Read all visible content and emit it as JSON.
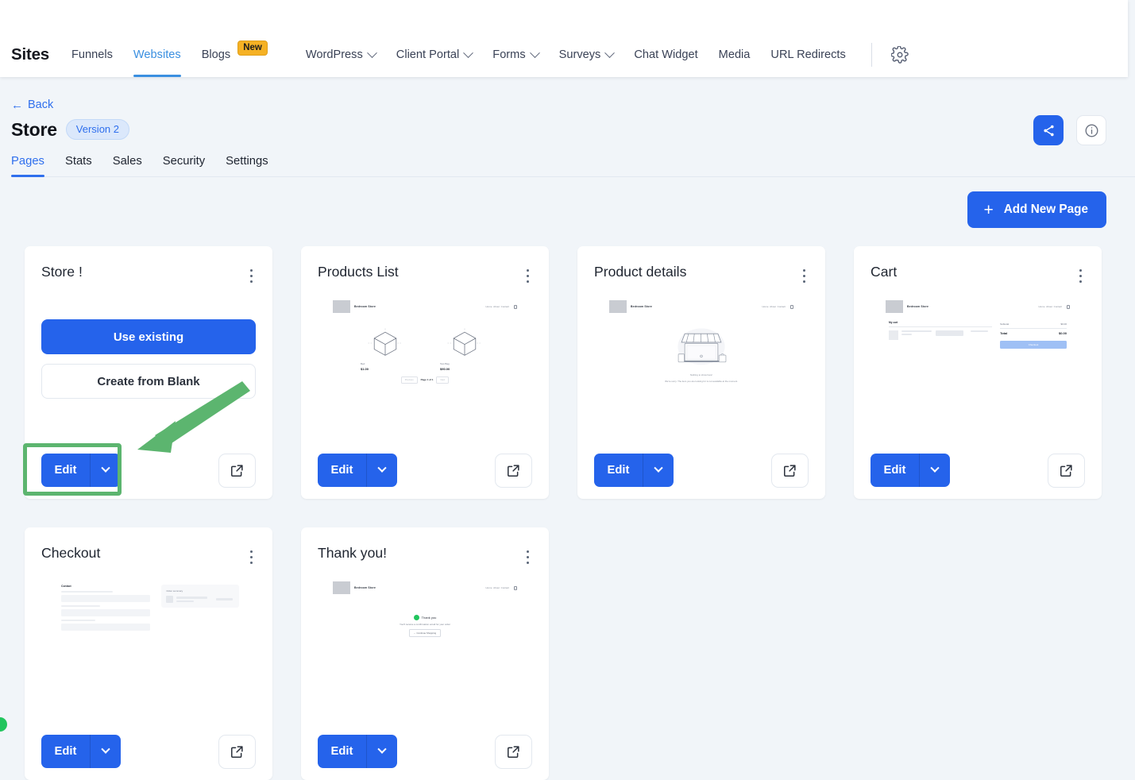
{
  "topnav": {
    "brand": "Sites",
    "items": [
      {
        "label": "Funnels",
        "active": false,
        "caret": false,
        "badge": null
      },
      {
        "label": "Websites",
        "active": true,
        "caret": false,
        "badge": null
      },
      {
        "label": "Blogs",
        "active": false,
        "caret": false,
        "badge": "New"
      },
      {
        "label": "WordPress",
        "active": false,
        "caret": true,
        "badge": null
      },
      {
        "label": "Client Portal",
        "active": false,
        "caret": true,
        "badge": null
      },
      {
        "label": "Forms",
        "active": false,
        "caret": true,
        "badge": null
      },
      {
        "label": "Surveys",
        "active": false,
        "caret": true,
        "badge": null
      },
      {
        "label": "Chat Widget",
        "active": false,
        "caret": false,
        "badge": null
      },
      {
        "label": "Media",
        "active": false,
        "caret": false,
        "badge": null
      },
      {
        "label": "URL Redirects",
        "active": false,
        "caret": false,
        "badge": null
      }
    ],
    "settings_icon": "gear-icon"
  },
  "header": {
    "back_label": "Back",
    "back_arrow": "←",
    "title": "Store",
    "version_badge": "Version 2",
    "tabs": [
      {
        "label": "Pages",
        "active": true
      },
      {
        "label": "Stats",
        "active": false
      },
      {
        "label": "Sales",
        "active": false
      },
      {
        "label": "Security",
        "active": false
      },
      {
        "label": "Settings",
        "active": false
      }
    ],
    "actions": [
      {
        "name": "share-icon",
        "style": "primary"
      },
      {
        "name": "info-icon",
        "style": "plain"
      }
    ]
  },
  "toolbar": {
    "add_page_label": "Add New Page",
    "add_page_plus": "+"
  },
  "colors": {
    "primary_blue": "#2563eb",
    "link_blue": "#2f6fed",
    "active_nav_blue": "#3a8fe0",
    "badge_amber": "#f5b124",
    "highlight_green": "#5cb56f",
    "page_background": "#f1f5f9",
    "card_background": "#ffffff"
  },
  "cards": [
    {
      "title": "Store !",
      "thumb_type": "actions",
      "menu_icon": "kebab-menu-icon",
      "use_existing_label": "Use existing",
      "create_blank_label": "Create from Blank",
      "edit_label": "Edit",
      "caret_icon": "chevron-down-icon",
      "open_icon": "external-link-icon",
      "highlighted": true
    },
    {
      "title": "Products List",
      "thumb_type": "products",
      "menu_icon": "kebab-menu-icon",
      "edit_label": "Edit",
      "caret_icon": "chevron-down-icon",
      "open_icon": "external-link-icon",
      "highlighted": false,
      "thumb": {
        "brand": "Bedroom Store",
        "nav": [
          "Home",
          "About",
          "Contact"
        ],
        "cart_icon": "shopping-cart-icon",
        "products": [
          {
            "name": "Bed",
            "price": "$1.00"
          },
          {
            "name": "Test Bag",
            "price": "$90.00"
          }
        ],
        "prev_label": "Previous",
        "page_label": "Page 1 of 1",
        "next_label": "Next"
      }
    },
    {
      "title": "Product details",
      "thumb_type": "storefront",
      "menu_icon": "kebab-menu-icon",
      "edit_label": "Edit",
      "caret_icon": "chevron-down-icon",
      "open_icon": "external-link-icon",
      "highlighted": false,
      "thumb": {
        "brand": "Bedroom Store",
        "nav": [
          "Home",
          "About",
          "Contact"
        ],
        "cart_icon": "shopping-cart-icon",
        "illustration": "storefront-illustration",
        "headline": "Nothing to show here!",
        "subtext": "We're sorry. The item you are looking for is not available at the moment."
      }
    },
    {
      "title": "Cart",
      "thumb_type": "cart",
      "menu_icon": "kebab-menu-icon",
      "edit_label": "Edit",
      "caret_icon": "chevron-down-icon",
      "open_icon": "external-link-icon",
      "highlighted": false,
      "thumb": {
        "brand": "Bedroom Store",
        "nav": [
          "Home",
          "About",
          "Contact"
        ],
        "cart_icon": "shopping-cart-icon",
        "section_label": "My cart",
        "summary": [
          {
            "label": "Subtotal",
            "value": "$0.00"
          },
          {
            "label": "Total",
            "value": "$0.00"
          }
        ],
        "checkout_label": "Checkout"
      }
    },
    {
      "title": "Checkout",
      "thumb_type": "checkout",
      "menu_icon": "kebab-menu-icon",
      "edit_label": "Edit",
      "caret_icon": "chevron-down-icon",
      "open_icon": "external-link-icon",
      "highlighted": false,
      "thumb": {
        "section_label": "Contact",
        "summary_label": "Order summary"
      }
    },
    {
      "title": "Thank you!",
      "thumb_type": "thankyou",
      "menu_icon": "kebab-menu-icon",
      "edit_label": "Edit",
      "caret_icon": "chevron-down-icon",
      "open_icon": "external-link-icon",
      "highlighted": false,
      "thumb": {
        "brand": "Bedroom Store",
        "nav": [
          "Home",
          "About",
          "Contact"
        ],
        "cart_icon": "shopping-cart-icon",
        "check_icon": "check-circle-icon",
        "headline": "Thank you",
        "subtext": "You'll receive a confirmation email for your order",
        "button_label": "Continue Shopping"
      }
    }
  ],
  "annotation": {
    "type": "arrow-pointing-to-edit-button",
    "highlight_color": "#5cb56f"
  }
}
